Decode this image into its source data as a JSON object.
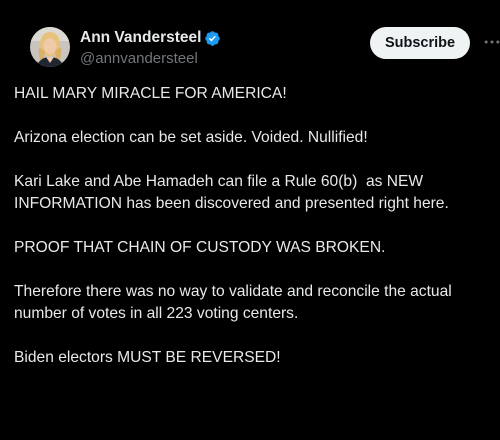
{
  "post": {
    "author": {
      "display_name": "Ann Vandersteel",
      "handle": "@annvandersteel",
      "verified": true,
      "avatar_icon": "profile-photo",
      "verified_color": "#1d9bf0"
    },
    "subscribe_label": "Subscribe",
    "more_icon": "ellipsis-icon",
    "paragraphs": [
      "HAIL MARY MIRACLE FOR AMERICA!",
      "Arizona election can be set aside. Voided. Nullified!",
      "Kari Lake and Abe Hamadeh can file a Rule 60(b)  as NEW INFORMATION has been discovered and presented right here.",
      "PROOF THAT CHAIN OF CUSTODY WAS BROKEN.",
      "Therefore there was no way to validate and reconcile the actual number of votes in all 223 voting centers.",
      "Biden electors MUST BE REVERSED!"
    ]
  },
  "colors": {
    "background": "#000000",
    "text": "#e7e9ea",
    "secondary_text": "#71767b",
    "button_bg": "#eff3f4",
    "button_text": "#0f1419"
  }
}
